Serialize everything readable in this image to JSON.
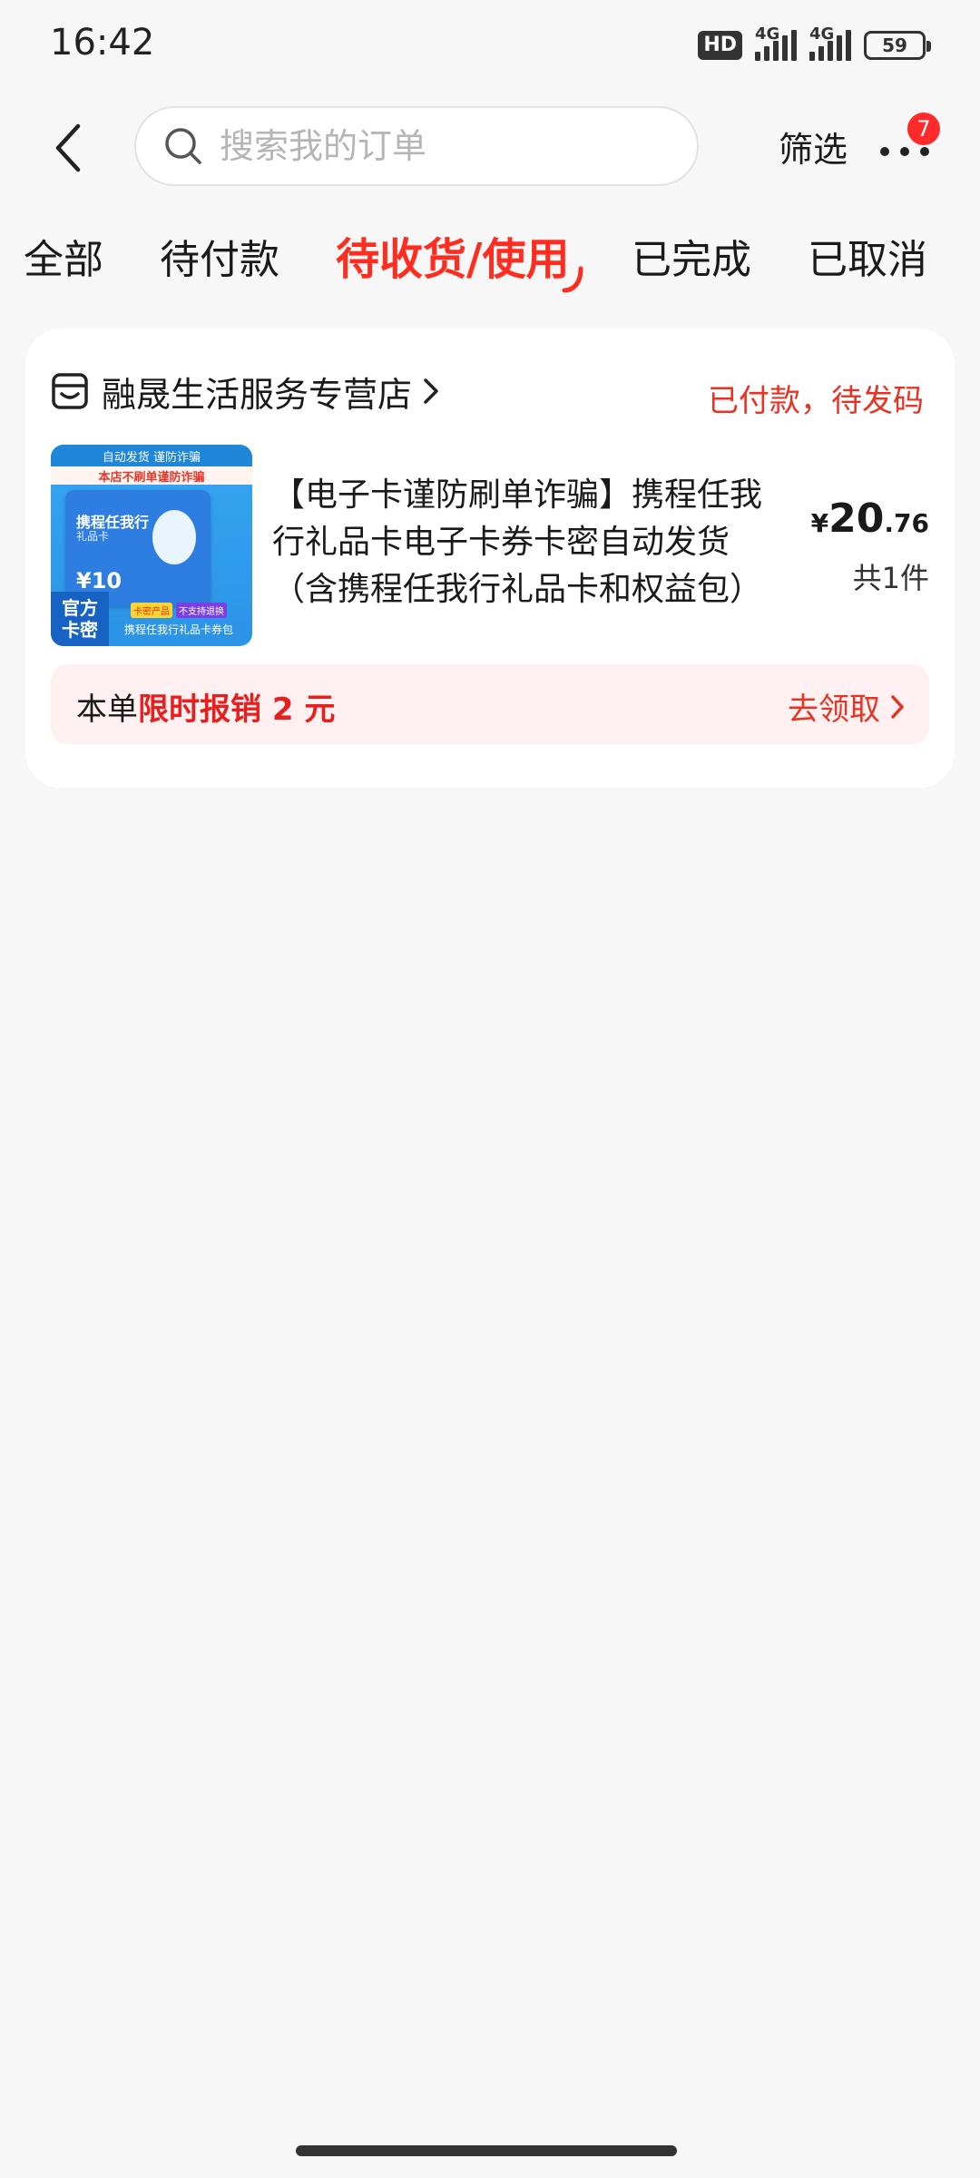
{
  "status_bar": {
    "time": "16:42",
    "hd_label": "HD",
    "network1": "4G",
    "network2": "4G",
    "battery": "59"
  },
  "header": {
    "search_placeholder": "搜索我的订单",
    "filter_label": "筛选",
    "more_badge": "7"
  },
  "tabs": [
    {
      "label": "全部",
      "active": false
    },
    {
      "label": "待付款",
      "active": false
    },
    {
      "label": "待收货/使用",
      "active": true
    },
    {
      "label": "已完成",
      "active": false
    },
    {
      "label": "已取消",
      "active": false
    }
  ],
  "order": {
    "store_name": "融晟生活服务专营店",
    "status": "已付款，待发码",
    "product": {
      "title": "【电子卡谨防刷单诈骗】携程任我行礼品卡电子卡券卡密自动发货（含携程任我行礼品卡和权益包）",
      "price_currency": "¥",
      "price_integer": "20",
      "price_decimal": ".76",
      "quantity": "共1件"
    },
    "thumbnail": {
      "banner": "自动发货 谨防诈骗",
      "red_line": "本店不刷单谨防诈骗",
      "card_title": "携程任我行",
      "card_sub": "礼品卡",
      "card_value": "¥10",
      "official_line1": "官方",
      "official_line2": "卡密",
      "tag_yellow": "卡密产品",
      "tag_purple": "不支持退换",
      "bottom_text": "携程任我行礼品卡券包"
    },
    "promo": {
      "prefix": "本单",
      "highlight": "限时报销 2 元",
      "action": "去领取"
    }
  },
  "colors": {
    "accent": "#ff2d1f",
    "status_red": "#e63324",
    "promo_bg": "#fff1f1",
    "page_bg": "#f7f7f7"
  }
}
